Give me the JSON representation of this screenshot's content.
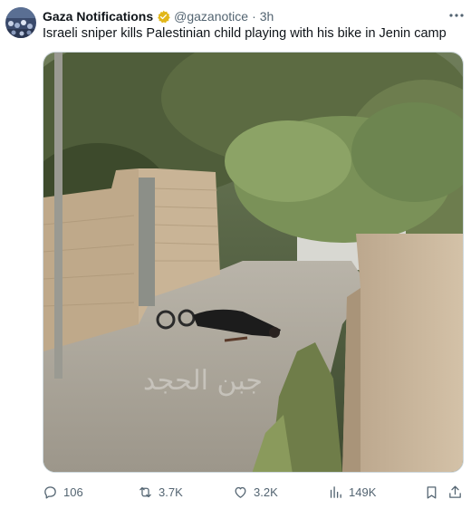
{
  "tweet": {
    "author_name": "Gaza Notifications",
    "handle": "@gazanotice",
    "separator": "·",
    "time": "3h",
    "text": "Israeli sniper kills Palestinian child playing with his bike in Jenin camp",
    "more_icon": "more-icon",
    "verified_icon": "verified-badge-icon",
    "accent_color": "#1d9bf0",
    "badge_color": "#e2b719"
  },
  "media": {
    "watermark_text": "جبن الحجد"
  },
  "actions": {
    "replies": "106",
    "reposts": "3.7K",
    "likes": "3.2K",
    "views": "149K"
  }
}
